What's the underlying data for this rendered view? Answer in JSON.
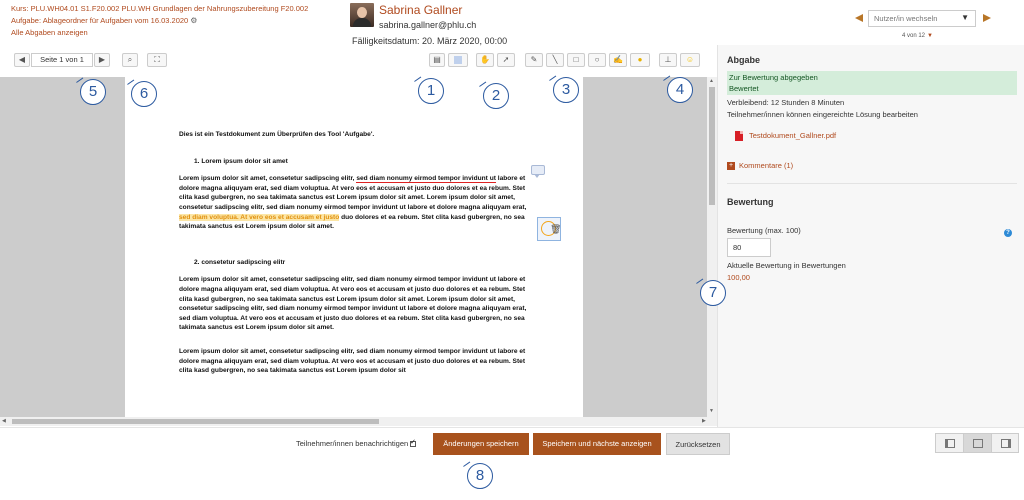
{
  "course": {
    "line1": "Kurs: PLU.WH04.01 S1.F20.002 PLU.WH Grundlagen der Nahrungszubereitung F20.002",
    "line2": "Aufgabe: Ablageordner für Aufgaben vom 16.03.2020",
    "line3": "Alle Abgaben anzeigen"
  },
  "user": {
    "name": "Sabrina Gallner",
    "email": "sabrina.gallner@phlu.ch",
    "due_date": "Fälligkeitsdatum: 20. März 2020, 00:00"
  },
  "user_switch": {
    "placeholder": "Nutzer/in wechseln",
    "counter": "4 von 12"
  },
  "toolbar": {
    "page_label": "Seite 1 von 1"
  },
  "document": {
    "title": "Dies ist ein Testdokument zum Überprüfen des Tool 'Aufgabe'.",
    "heading1": "1.    Lorem ipsum dolor sit amet",
    "p1_a": "Lorem ipsum dolor sit amet, consetetur sadipscing elitr, ",
    "p1_underlined": "sed diam nonumy eirmod tempor invidunt ut",
    "p1_b": " labore et dolore magna aliquyam erat, sed diam voluptua. At vero eos et accusam et justo duo dolores et ea rebum. Stet clita kasd gubergren, no sea takimata sanctus est Lorem ipsum dolor sit amet. Lorem ipsum dolor sit amet, consetetur sadipscing elitr, sed diam nonumy eirmod tempor invidunt ut labore et dolore magna aliquyam erat, ",
    "p1_highlighted": "sed diam voluptua. At vero eos et accusam et justo",
    "p1_c": " duo dolores et ea rebum. Stet clita kasd gubergren, no sea takimata sanctus est Lorem ipsum dolor sit amet.",
    "heading2": "2.    consetetur sadipscing elitr",
    "p2": "Lorem ipsum dolor sit amet, consetetur sadipscing elitr, sed diam nonumy eirmod tempor invidunt ut labore et dolore magna aliquyam erat, sed diam voluptua. At vero eos et accusam et justo duo dolores et ea rebum. Stet clita kasd gubergren, no sea takimata sanctus est Lorem ipsum dolor sit amet. Lorem ipsum dolor sit amet, consetetur sadipscing elitr, sed diam nonumy eirmod tempor invidunt ut labore et dolore magna aliquyam erat, sed diam voluptua. At vero eos et accusam et justo duo dolores et ea rebum. Stet clita kasd gubergren, no sea takimata sanctus est Lorem ipsum dolor sit amet.",
    "p3": "Lorem ipsum dolor sit amet, consetetur sadipscing elitr, sed diam nonumy eirmod tempor invidunt ut labore et dolore magna aliquyam erat, sed diam voluptua. At vero eos et accusam et justo duo dolores et ea rebum. Stet clita kasd gubergren, no sea takimata sanctus est Lorem ipsum dolor sit"
  },
  "submission": {
    "title": "Abgabe",
    "status1": "Zur Bewertung abgegeben",
    "status2": "Bewertet",
    "remaining": "Verbleibend: 12 Stunden 8 Minuten",
    "edit_note": "Teilnehmer/innen können eingereichte Lösung bearbeiten",
    "file": "Testdokument_Gallner.pdf",
    "comments": "Kommentare (1)"
  },
  "grading": {
    "title": "Bewertung",
    "label": "Bewertung (max. 100)",
    "value": "80",
    "current_label": "Aktuelle Bewertung in Bewertungen",
    "current_value": "100,00"
  },
  "footer": {
    "notify": "Teilnehmer/innen benachrichtigen",
    "save": "Änderungen speichern",
    "save_next": "Speichern und nächste anzeigen",
    "reset": "Zurücksetzen"
  },
  "callouts": [
    "1",
    "2",
    "3",
    "4",
    "5",
    "6",
    "7",
    "8"
  ],
  "colors": {
    "accent": "#b04a1e",
    "primary_button": "#a8521d",
    "status_bg": "#d4edda",
    "callout": "#2c5aa0"
  }
}
